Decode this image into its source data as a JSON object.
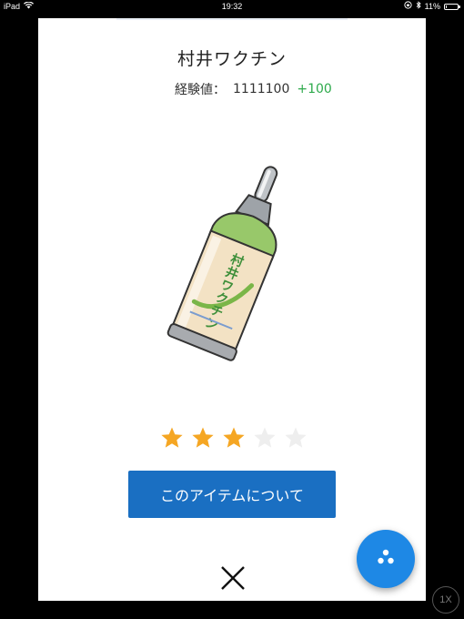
{
  "status_bar": {
    "device": "iPad",
    "time": "19:32",
    "battery_text": "11%",
    "battery_level": 0.11,
    "icons": [
      "wifi-icon",
      "lock-rotation-icon",
      "bluetooth-icon",
      "battery-icon"
    ]
  },
  "item": {
    "name": "村井ワクチン",
    "exp_label": "経験値：",
    "exp_value": "1111100",
    "exp_bonus": "+100",
    "bottle_label": "村井ワクチン",
    "rating": 3,
    "rating_max": 5
  },
  "buttons": {
    "about": "このアイテムについて",
    "close_icon": "close-icon",
    "fab_icon": "three-dots-icon",
    "speed": "1X"
  },
  "colors": {
    "accent_blue": "#1a6fc2",
    "fab_blue": "#1e88e5",
    "bonus_green": "#2eaa4c",
    "star_on": "#f5a623",
    "star_off": "#eeeeee"
  }
}
